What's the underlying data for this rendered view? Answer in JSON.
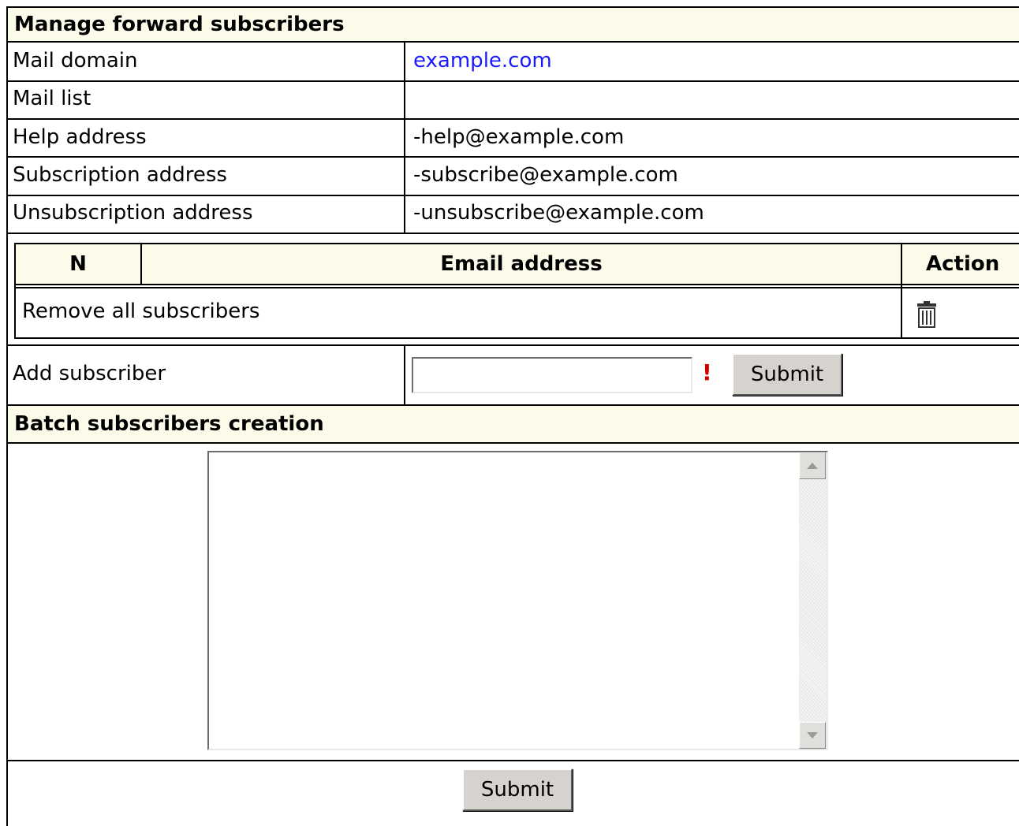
{
  "manage": {
    "title": "Manage forward subscribers",
    "rows": [
      {
        "label": "Mail domain",
        "value": "example.com",
        "is_link": true
      },
      {
        "label": "Mail list",
        "value": ""
      },
      {
        "label": "Help address",
        "value": "-help@example.com"
      },
      {
        "label": "Subscription address",
        "value": "-subscribe@example.com"
      },
      {
        "label": "Unsubscription address",
        "value": "-unsubscribe@example.com"
      }
    ]
  },
  "subscribers_table": {
    "headers": {
      "n": "N",
      "email": "Email address",
      "action": "Action"
    },
    "remove_all_label": "Remove all subscribers",
    "remove_icon": "trash-icon"
  },
  "add_subscriber": {
    "label": "Add subscriber",
    "input_value": "",
    "required_mark": "!",
    "submit_label": "Submit"
  },
  "batch": {
    "title": "Batch subscribers creation",
    "textarea_value": "",
    "submit_label": "Submit"
  },
  "colors": {
    "header_bg": "#fcfbea",
    "link": "#1a1aff",
    "required": "#cc0000",
    "button_bg": "#d6d3ce"
  }
}
